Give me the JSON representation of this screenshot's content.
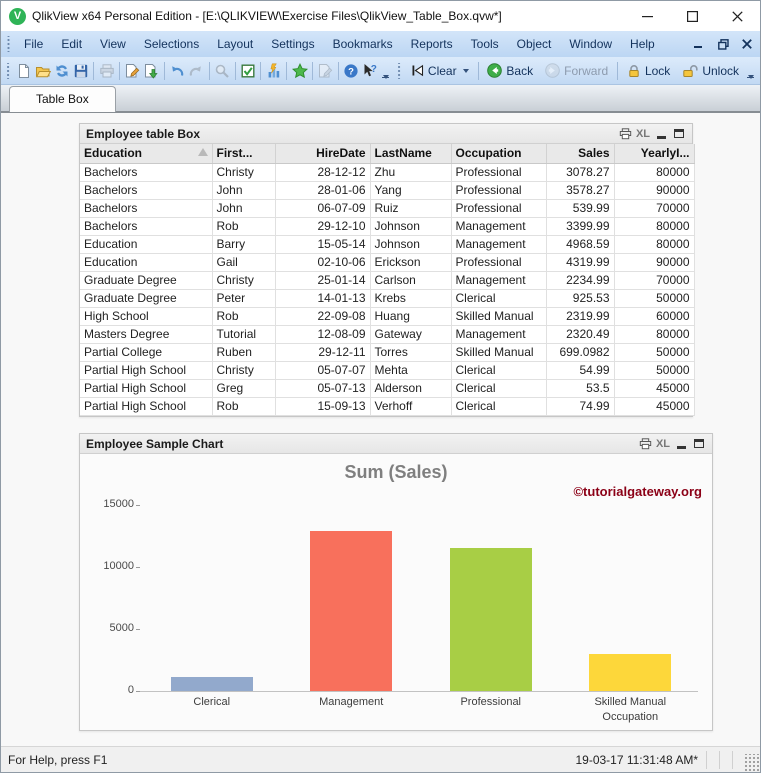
{
  "window": {
    "title": "QlikView x64 Personal Edition - [E:\\QLIKVIEW\\Exercise Files\\QlikView_Table_Box.qvw*]",
    "controls": [
      "minimize",
      "maximize",
      "close"
    ]
  },
  "menubar": {
    "items": [
      "File",
      "Edit",
      "View",
      "Selections",
      "Layout",
      "Settings",
      "Bookmarks",
      "Reports",
      "Tools",
      "Object",
      "Window",
      "Help"
    ],
    "mdi_controls": [
      "minimize",
      "restore",
      "close"
    ]
  },
  "toolbar": {
    "standard_icons": [
      "new-document-icon",
      "open-file-icon",
      "refresh-icon",
      "save-icon",
      "print-icon",
      "edit-script-icon",
      "reload-data-icon",
      "undo-icon",
      "redo-icon",
      "search-icon",
      "current-selections-icon",
      "quick-chart-wizard-icon",
      "add-bookmark-icon",
      "edit-module-icon",
      "help-icon",
      "whats-this-help-icon"
    ],
    "navigation": {
      "clear_label": "Clear",
      "back_label": "Back",
      "forward_label": "Forward",
      "lock_label": "Lock",
      "unlock_label": "Unlock"
    }
  },
  "tabs": [
    {
      "label": "Table Box",
      "active": true
    }
  ],
  "table_box": {
    "caption": "Employee table Box",
    "caption_icons": [
      "print-icon",
      "excel-export-icon",
      "minimize-icon",
      "maximize-icon"
    ],
    "columns": [
      {
        "label": "Education",
        "align": "left",
        "sorted": true
      },
      {
        "label": "First...",
        "align": "left",
        "sorted": false
      },
      {
        "label": "HireDate",
        "align": "right",
        "sorted": false
      },
      {
        "label": "LastName",
        "align": "left",
        "sorted": false
      },
      {
        "label": "Occupation",
        "align": "left",
        "sorted": false
      },
      {
        "label": "Sales",
        "align": "right",
        "sorted": false
      },
      {
        "label": "YearlyI...",
        "align": "right",
        "sorted": false
      }
    ],
    "rows": [
      [
        "Bachelors",
        "Christy",
        "28-12-12",
        "Zhu",
        "Professional",
        "3078.27",
        "80000"
      ],
      [
        "Bachelors",
        "John",
        "28-01-06",
        "Yang",
        "Professional",
        "3578.27",
        "90000"
      ],
      [
        "Bachelors",
        "John",
        "06-07-09",
        "Ruiz",
        "Professional",
        "539.99",
        "70000"
      ],
      [
        "Bachelors",
        "Rob",
        "29-12-10",
        "Johnson",
        "Management",
        "3399.99",
        "80000"
      ],
      [
        "Education",
        "Barry",
        "15-05-14",
        "Johnson",
        "Management",
        "4968.59",
        "80000"
      ],
      [
        "Education",
        "Gail",
        "02-10-06",
        "Erickson",
        "Professional",
        "4319.99",
        "90000"
      ],
      [
        "Graduate Degree",
        "Christy",
        "25-01-14",
        "Carlson",
        "Management",
        "2234.99",
        "70000"
      ],
      [
        "Graduate Degree",
        "Peter",
        "14-01-13",
        "Krebs",
        "Clerical",
        "925.53",
        "50000"
      ],
      [
        "High School",
        "Rob",
        "22-09-08",
        "Huang",
        "Skilled Manual",
        "2319.99",
        "60000"
      ],
      [
        "Masters Degree",
        "Tutorial",
        "12-08-09",
        "Gateway",
        "Management",
        "2320.49",
        "80000"
      ],
      [
        "Partial College",
        "Ruben",
        "29-12-11",
        "Torres",
        "Skilled Manual",
        "699.0982",
        "50000"
      ],
      [
        "Partial High School",
        "Christy",
        "05-07-07",
        "Mehta",
        "Clerical",
        "54.99",
        "50000"
      ],
      [
        "Partial High School",
        "Greg",
        "05-07-13",
        "Alderson",
        "Clerical",
        "53.5",
        "45000"
      ],
      [
        "Partial High School",
        "Rob",
        "15-09-13",
        "Verhoff",
        "Clerical",
        "74.99",
        "45000"
      ]
    ]
  },
  "chart": {
    "caption": "Employee Sample Chart",
    "caption_icons": [
      "print-icon",
      "excel-export-icon",
      "minimize-icon",
      "maximize-icon"
    ],
    "watermark": "©tutorialgateway.org"
  },
  "chart_data": {
    "type": "bar",
    "title": "Sum (Sales)",
    "categories": [
      "Clerical",
      "Management",
      "Professional",
      "Skilled Manual"
    ],
    "values": [
      1109.01,
      12924.06,
      11516.52,
      3019.09
    ],
    "bar_colors": [
      "#92a9cc",
      "#f8705c",
      "#a8ce45",
      "#fdd73a"
    ],
    "xlabel": "Occupation",
    "ylabel": "",
    "ylim": [
      0,
      15000
    ],
    "yticks": [
      0,
      5000,
      10000,
      15000
    ],
    "grid": false,
    "legend": "none"
  },
  "statusbar": {
    "left": "For Help, press F1",
    "time": "19-03-17 11:31:48 AM*"
  }
}
